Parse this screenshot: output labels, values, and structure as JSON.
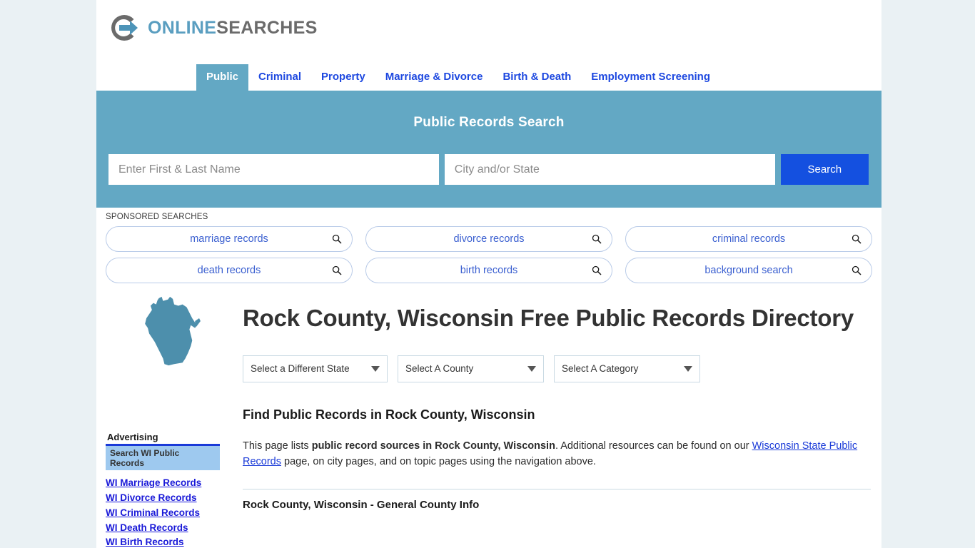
{
  "brand": {
    "name_part1": "ONLINE",
    "name_part2": "SEARCHES",
    "logo_icon": "circle-arrow-icon",
    "accent_blue": "#5a9ec0",
    "gray": "#6b6b6b"
  },
  "nav": {
    "items": [
      {
        "label": "Public",
        "active": true
      },
      {
        "label": "Criminal",
        "active": false
      },
      {
        "label": "Property",
        "active": false
      },
      {
        "label": "Marriage & Divorce",
        "active": false
      },
      {
        "label": "Birth & Death",
        "active": false
      },
      {
        "label": "Employment Screening",
        "active": false
      }
    ]
  },
  "search_banner": {
    "title": "Public Records Search",
    "name_placeholder": "Enter First & Last Name",
    "name_value": "",
    "place_placeholder": "City and/or State",
    "place_value": "",
    "button_label": "Search",
    "background": "#63a8c4",
    "button_color": "#1450e0"
  },
  "sponsored": {
    "label": "SPONSORED SEARCHES",
    "pills": [
      {
        "label": "marriage records",
        "icon": "search-icon"
      },
      {
        "label": "divorce records",
        "icon": "search-icon"
      },
      {
        "label": "criminal records",
        "icon": "search-icon"
      },
      {
        "label": "death records",
        "icon": "search-icon"
      },
      {
        "label": "birth records",
        "icon": "search-icon"
      },
      {
        "label": "background search",
        "icon": "search-icon"
      }
    ]
  },
  "sidebar": {
    "state_map_icon": "wisconsin-state-map-icon",
    "advertising_label": "Advertising",
    "advert_header": "Search WI Public Records",
    "links": [
      {
        "label": "WI Marriage Records"
      },
      {
        "label": "WI Divorce Records"
      },
      {
        "label": "WI Criminal Records"
      },
      {
        "label": "WI Death Records"
      },
      {
        "label": "WI Birth Records"
      }
    ]
  },
  "main": {
    "page_title": "Rock County, Wisconsin Free Public Records Directory",
    "selects": [
      {
        "value": "Select a Different State"
      },
      {
        "value": "Select A County"
      },
      {
        "value": "Select A Category"
      }
    ],
    "section_heading": "Find Public Records in Rock County, Wisconsin",
    "paragraph": {
      "part1": "This page lists ",
      "bold1": "public record sources in Rock County, Wisconsin",
      "part2": ". Additional resources can be found on our ",
      "link": "Wisconsin State Public Records",
      "part3": " page, on city pages, and on topic pages using the navigation above."
    },
    "table_section_title": "Rock County, Wisconsin - General County Info"
  }
}
